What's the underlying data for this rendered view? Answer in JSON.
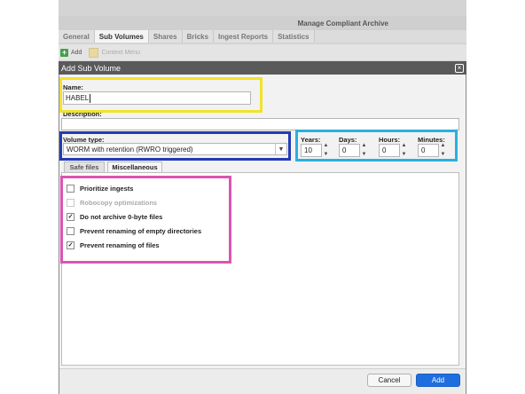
{
  "window": {
    "title": "Manage Compliant Archive",
    "tabs": [
      "General",
      "Sub Volumes",
      "Shares",
      "Bricks",
      "Ingest Reports",
      "Statistics"
    ],
    "active_tab": "Sub Volumes"
  },
  "toolbar": {
    "add_label": "Add",
    "context_menu_label": "Context Menu"
  },
  "dialog": {
    "title": "Add Sub Volume",
    "close_icon": "close-icon",
    "name": {
      "label": "Name:",
      "value": "HABEL"
    },
    "description": {
      "label": "Description:",
      "value": ""
    },
    "volume_type": {
      "label": "Volume type:",
      "selected": "WORM with retention (RWRO triggered)"
    },
    "retention": {
      "years": {
        "label": "Years:",
        "value": "10"
      },
      "days": {
        "label": "Days:",
        "value": "0"
      },
      "hours": {
        "label": "Hours:",
        "value": "0"
      },
      "minutes": {
        "label": "Minutes:",
        "value": "0"
      }
    },
    "inner_tabs": [
      "Safe files",
      "Miscellaneous"
    ],
    "active_inner_tab": "Miscellaneous",
    "options": [
      {
        "label": "Prioritize ingests",
        "checked": false,
        "enabled": true
      },
      {
        "label": "Robocopy optimizations",
        "checked": false,
        "enabled": false
      },
      {
        "label": "Do not archive 0-byte files",
        "checked": true,
        "enabled": true
      },
      {
        "label": "Prevent renaming of empty directories",
        "checked": false,
        "enabled": true
      },
      {
        "label": "Prevent renaming of files",
        "checked": true,
        "enabled": true
      }
    ],
    "buttons": {
      "cancel": "Cancel",
      "add": "Add"
    }
  },
  "colors": {
    "highlight_yellow": "#f3e22a",
    "highlight_blue": "#223bb5",
    "highlight_cyan": "#28b0e0",
    "highlight_pink": "#d955b4",
    "primary_button": "#1f6ee0",
    "dialog_titlebar": "#5a5a5a"
  }
}
